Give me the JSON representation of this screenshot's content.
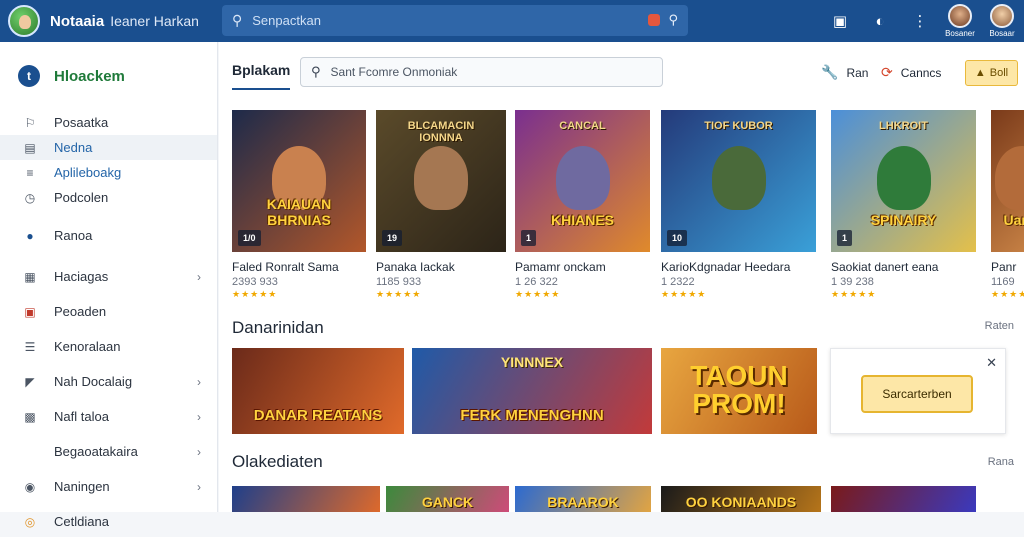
{
  "app": {
    "title": "Notaaia",
    "subtitle": "Ieaner Harkan"
  },
  "top_search": {
    "placeholder": "Senpactkan"
  },
  "top_icons": [
    "store-icon",
    "theme-icon",
    "more-icon"
  ],
  "users": [
    {
      "name": "Bosaner",
      "avatar_color": "#8b5a3c"
    },
    {
      "name": "Bosaar",
      "avatar_color": "#c98b5e"
    }
  ],
  "sidebar": {
    "brand": "Hloackem",
    "items": [
      {
        "label": "Posaatka",
        "icon": "bookmark-icon",
        "chevron": false,
        "active": false,
        "link": false
      },
      {
        "label": "Nedna",
        "icon": "news-icon",
        "chevron": false,
        "active": true,
        "link": false
      },
      {
        "label": "Aplileboakg",
        "icon": "list-icon",
        "chevron": false,
        "active": false,
        "link": true
      },
      {
        "label": "Podcolen",
        "icon": "clock-icon",
        "chevron": false,
        "active": false,
        "link": false
      },
      {
        "label": "Ranoa",
        "icon": "globe-icon",
        "chevron": false,
        "active": false,
        "link": false
      },
      {
        "label": "Haciagas",
        "icon": "grid-icon",
        "chevron": true,
        "active": false,
        "link": false
      },
      {
        "label": "Peoaden",
        "icon": "calendar-icon",
        "chevron": false,
        "active": false,
        "link": false
      },
      {
        "label": "Kenoralaan",
        "icon": "menu-icon",
        "chevron": false,
        "active": false,
        "link": false
      },
      {
        "label": "Nah Docalaig",
        "icon": "flag-icon",
        "chevron": true,
        "active": false,
        "link": false
      },
      {
        "label": "Nafl taloa",
        "icon": "apps-icon",
        "chevron": true,
        "active": false,
        "link": false
      },
      {
        "label": "Begaoatakaira",
        "icon": "",
        "chevron": true,
        "active": false,
        "link": false
      },
      {
        "label": "Naningen",
        "icon": "gamepad-icon",
        "chevron": true,
        "active": false,
        "link": false
      },
      {
        "label": "Cetldiana",
        "icon": "coin-icon",
        "chevron": false,
        "active": false,
        "link": false
      }
    ]
  },
  "content": {
    "tab_label": "Bplakam",
    "search_placeholder": "Sant Fcomre Onmoniak",
    "actions": [
      {
        "label": "Ran",
        "icon": "wrench-icon"
      },
      {
        "label": "Canncs",
        "icon": "refresh-icon"
      }
    ],
    "buy_label": "Boll",
    "games": [
      {
        "name": "Faled Ronralt Sama",
        "count": "2393 933",
        "badge": "1/0",
        "thumb_title": "KAIAUAN BHRNIAS",
        "top_title": "",
        "bg1": "#1d2a4a",
        "bg2": "#b2572a",
        "fig": "#c9814f"
      },
      {
        "name": "Panaka Iackak",
        "count": "1185 933",
        "badge": "19",
        "thumb_title": "",
        "top_title": "BLCAMACIN IONNNA",
        "bg1": "#5a4a2a",
        "bg2": "#2c2418",
        "fig": "#a57752"
      },
      {
        "name": "Pamamr onckam",
        "count": "1 26 322",
        "badge": "1",
        "thumb_title": "KHIANES",
        "top_title": "CANCAL",
        "bg1": "#7a2f8f",
        "bg2": "#e08a2b",
        "fig": "#6f6aa0"
      },
      {
        "name": "KarioKdgnadar Heedara",
        "count": "1 2322",
        "badge": "10",
        "thumb_title": "",
        "top_title": "TIOF KUBOR",
        "bg1": "#243a7a",
        "bg2": "#3aa0d8",
        "fig": "#4a6a3a"
      },
      {
        "name": "Saokiat danert eana",
        "count": "1 39 238",
        "badge": "1",
        "thumb_title": "SPINAIRY",
        "top_title": "LHKROIT",
        "bg1": "#4b8fd9",
        "bg2": "#e4c04a",
        "fig": "#2f7b3a"
      },
      {
        "name": "Panr",
        "count": "1169",
        "badge": "",
        "thumb_title": "Uann",
        "top_title": "",
        "bg1": "#7a3a1a",
        "bg2": "#d08a4a",
        "fig": "#b36b3a"
      }
    ],
    "stars": "★★★★★",
    "section1": {
      "title": "Danarinidan",
      "link": "Raten"
    },
    "banners": [
      {
        "text": "DANAR REATANS",
        "top": "",
        "bg1": "#6b2a1a",
        "bg2": "#e06a2a"
      },
      {
        "text": "FERK MENENGHNN",
        "top": "YINNNEX",
        "bg1": "#1f5aa8",
        "bg2": "#c23a3a"
      },
      {
        "text": "TAOUN PROM!",
        "top": "",
        "bg1": "#e8a640",
        "bg2": "#b85a1a"
      }
    ],
    "ad": {
      "button": "Sarcarterben"
    },
    "section2": {
      "title": "Olakediaten",
      "link": "Rana"
    },
    "row3": [
      {
        "text": "",
        "bg1": "#1f3f8a",
        "bg2": "#e06a2a"
      },
      {
        "text": "GANCK",
        "bg1": "#3c8a3c",
        "bg2": "#d04a7a"
      },
      {
        "text": "BRAAROK",
        "bg1": "#2c6ad0",
        "bg2": "#e4a540"
      },
      {
        "text": "OO KONIAANDS",
        "bg1": "#1a1a1a",
        "bg2": "#b8761a"
      },
      {
        "text": "",
        "bg1": "#7a1a1a",
        "bg2": "#3a3ac0"
      }
    ]
  }
}
